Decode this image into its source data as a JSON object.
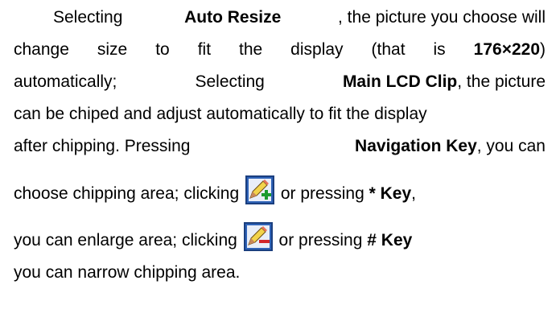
{
  "lines": [
    [
      "Selecting",
      "Auto Resize",
      ", the picture you choose will"
    ],
    [
      "change",
      "size",
      "to",
      "fit",
      "the",
      "display",
      "(that",
      "is",
      "176×220",
      ")"
    ],
    [
      "automatically;",
      "Selecting",
      "Main LCD Clip",
      ", the picture"
    ],
    [
      "can be chiped and adjust automatically to fit the display"
    ],
    [
      "after chipping. Pressing",
      "Navigation Key",
      ", you can"
    ],
    [
      "choose chipping area; clicking",
      "or pressing",
      "* Key",
      ","
    ],
    [
      "you can enlarge area; clicking",
      "or pressing",
      "# Key"
    ],
    [
      "you can narrow chipping area."
    ]
  ],
  "icons": {
    "zoom_in": "pencil-plus-icon",
    "zoom_out": "pencil-minus-icon"
  }
}
